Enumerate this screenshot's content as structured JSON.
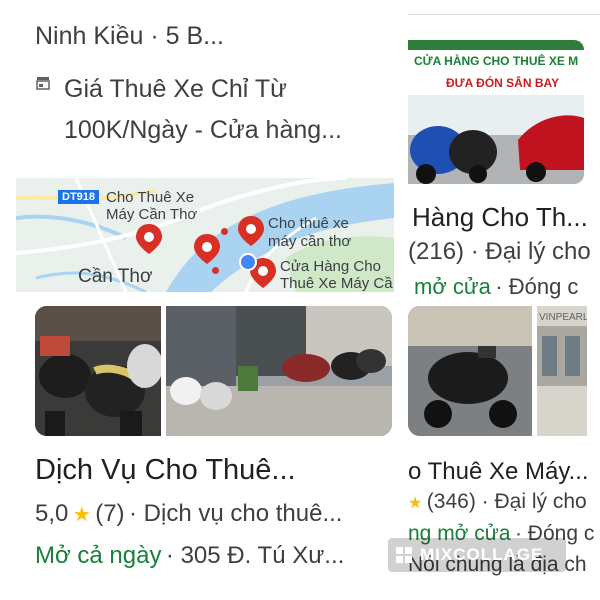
{
  "left_column": {
    "location": "Ninh Kiều · 5 B...",
    "snippet_line1": "Giá Thuê Xe Chỉ Từ",
    "snippet_line2": "100K/Ngày - Cửa hàng...",
    "map": {
      "road_label": "DT918",
      "place_label_1_line1": "Cho Thuê Xe",
      "place_label_1_line2": "Máy Cần Thơ",
      "place_label_2_line1": "Cho thuê xe",
      "place_label_2_line2": "máy cần thơ",
      "place_label_3_line1": "Cửa Hàng Cho",
      "place_label_3_line2": "Thuê Xe Máy Cầ",
      "city_label": "Cần Thơ"
    },
    "business_title": "Dịch Vụ Cho Thuê...",
    "rating": "5,0",
    "reviews": "(7)",
    "category": "· Dịch vụ cho thuê...",
    "hours": "Mở cả ngày",
    "address": "· 305 Đ. Tú Xư..."
  },
  "right_column": {
    "banner_line1": "CỬA HÀNG CHO THUÊ XE M",
    "banner_line2": "ĐƯA ĐÓN SÂN BAY",
    "title_1": "Hàng Cho Th...",
    "reviews_1": "(216) · Đại lý cho",
    "status_1": "mở cửa",
    "status_1_rest": "· Đóng c",
    "mall_sign": "VINPEARL",
    "title_2": "o Thuê Xe Máy...",
    "rating_2_reviews": "(346) · Đại lý cho",
    "status_2": "ng mở cửa",
    "status_2_rest": "· Đóng c",
    "note_2": "Nói chung là địa ch"
  },
  "watermark": "MIXCOLLAGE",
  "colors": {
    "text": "#3c4043",
    "green": "#188038",
    "star": "#fbbc04",
    "pin": "#d93025",
    "water": "#c5dff5",
    "land": "#e8eef0"
  }
}
